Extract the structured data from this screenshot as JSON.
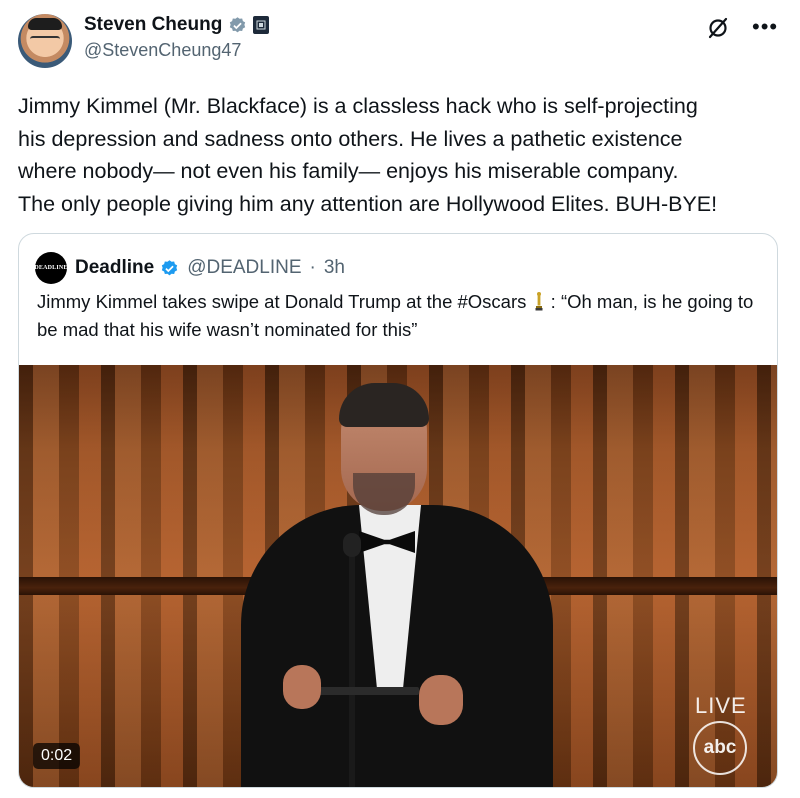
{
  "author": {
    "name": "Steven Cheung",
    "handle": "@StevenCheung47"
  },
  "tweet": {
    "text": "Jimmy Kimmel (Mr. Blackface) is a classless hack who is self-projecting\nhis depression and sadness onto others. He lives a pathetic existence\nwhere nobody— not even his family— enjoys his miserable company.\nThe only people giving him any attention are Hollywood Elites. BUH-BYE!"
  },
  "quote": {
    "avatar_text": "DEADLINE",
    "name": "Deadline",
    "handle": "@DEADLINE",
    "separator": "·",
    "time": "3h",
    "text_before": "Jimmy Kimmel takes swipe at Donald Trump at the #Oscars ",
    "text_after": " : “Oh man, is he going to be mad that his wife wasn’t nominated for this”"
  },
  "media": {
    "live_label": "LIVE",
    "network_logo": "abc",
    "timestamp": "0:02"
  },
  "icons": {
    "verified": "verified-badge-icon",
    "grok": "grok-icon",
    "more": "more-icon",
    "oscar": "oscar-statue-icon"
  },
  "colors": {
    "verified_blue": "#1d9bf0",
    "secondary_text": "#536471",
    "border": "#cfd9de"
  }
}
